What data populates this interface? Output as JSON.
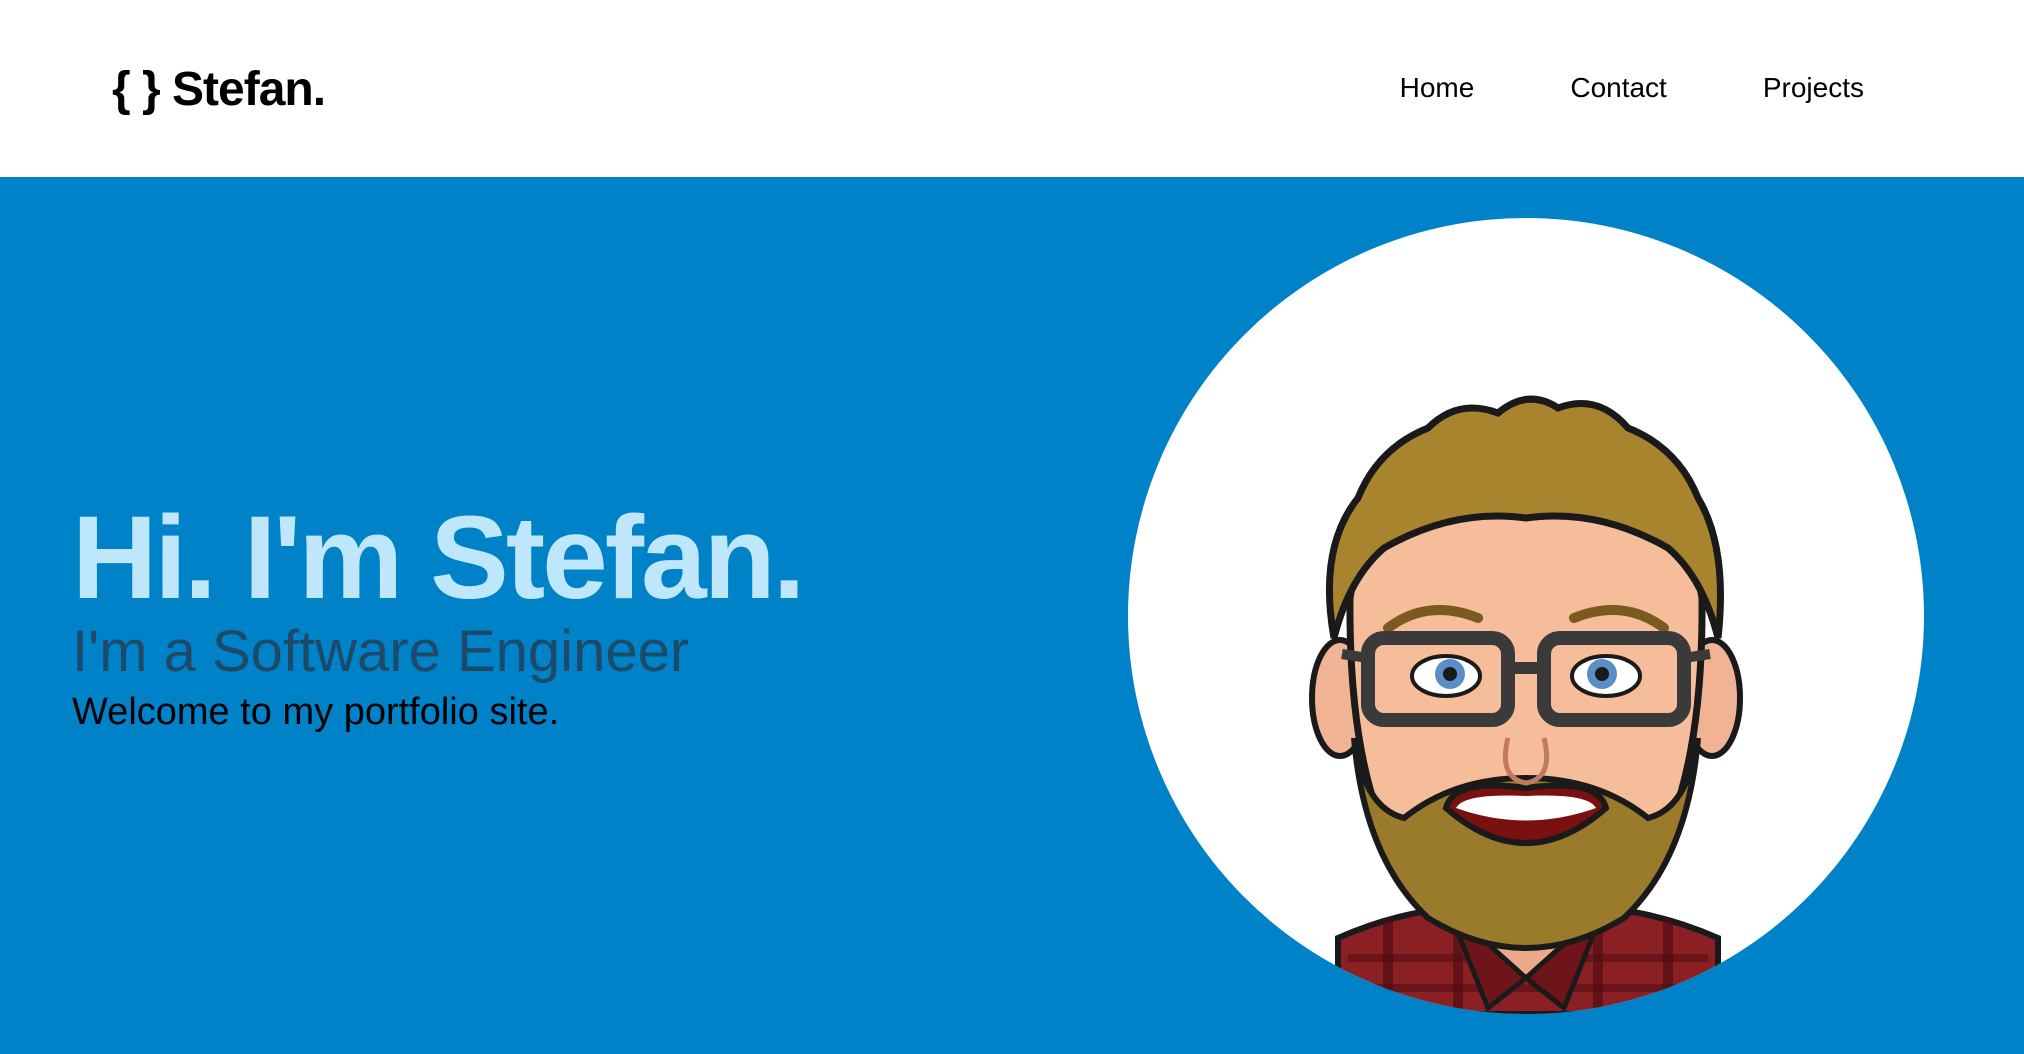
{
  "brand": {
    "logo_text": "{ } Stefan."
  },
  "nav": {
    "items": [
      {
        "label": "Home"
      },
      {
        "label": "Contact"
      },
      {
        "label": "Projects"
      }
    ]
  },
  "hero": {
    "title": "Hi. I'm Stefan.",
    "subtitle": "I'm a Software Engineer",
    "welcome": "Welcome to my portfolio site.",
    "avatar": "avatar-illustration"
  },
  "colors": {
    "hero_background": "#0082c8",
    "title_color": "#bfe7fb",
    "subtitle_color": "#1e4a69",
    "nav_background": "#ffffff"
  }
}
